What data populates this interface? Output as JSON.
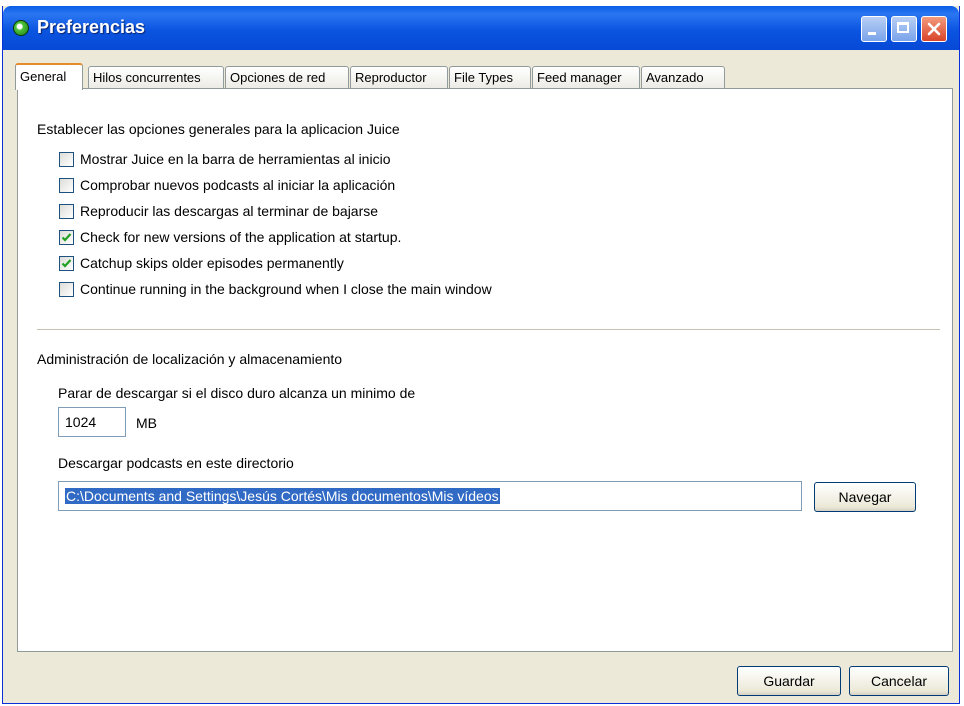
{
  "window": {
    "title": "Preferencias"
  },
  "tabs": [
    {
      "label": "General",
      "active": true
    },
    {
      "label": "Hilos concurrentes"
    },
    {
      "label": "Opciones de red"
    },
    {
      "label": "Reproductor"
    },
    {
      "label": "File Types"
    },
    {
      "label": "Feed manager"
    },
    {
      "label": "Avanzado"
    }
  ],
  "general": {
    "heading": "Establecer las opciones generales para la aplicacion Juice",
    "options": [
      {
        "label": "Mostrar Juice en la barra de herramientas al inicio",
        "checked": false
      },
      {
        "label": "Comprobar nuevos podcasts al iniciar la aplicación",
        "checked": false
      },
      {
        "label": "Reproducir las descargas al terminar de bajarse",
        "checked": false
      },
      {
        "label": "Check for new versions of the application at startup.",
        "checked": true
      },
      {
        "label": "Catchup skips older episodes permanently",
        "checked": true
      },
      {
        "label": "Continue running in the background when I close the main window",
        "checked": false
      }
    ]
  },
  "storage": {
    "heading": "Administración de localización y almacenamiento",
    "min_disk_label": "Parar de descargar si el disco duro alcanza un minimo de",
    "min_disk_value": "1024",
    "min_disk_unit": "MB",
    "dir_label": "Descargar podcasts en este directorio",
    "dir_value": "C:\\Documents and Settings\\Jesús Cortés\\Mis documentos\\Mis vídeos",
    "browse_label": "Navegar"
  },
  "footer": {
    "save_label": "Guardar",
    "cancel_label": "Cancelar"
  }
}
